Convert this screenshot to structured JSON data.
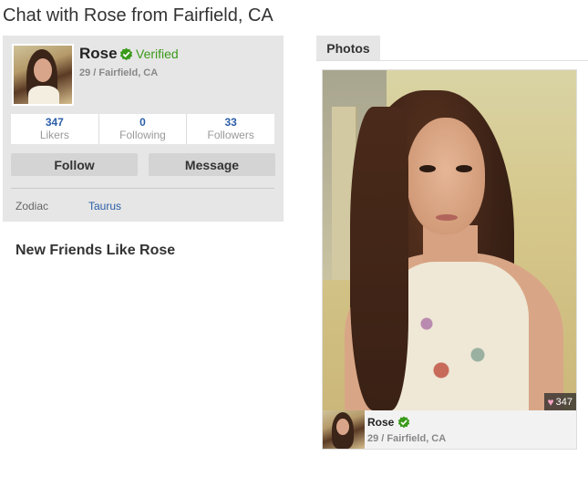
{
  "page": {
    "title": "Chat with Rose from Fairfield, CA"
  },
  "profile": {
    "name": "Rose",
    "verified_label": "Verified",
    "meta": "29 / Fairfield, CA",
    "stats": [
      {
        "value": "347",
        "label": "Likers"
      },
      {
        "value": "0",
        "label": "Following"
      },
      {
        "value": "33",
        "label": "Followers"
      }
    ],
    "buttons": {
      "follow": "Follow",
      "message": "Message"
    },
    "details": {
      "zodiac_label": "Zodiac",
      "zodiac_value": "Taurus"
    }
  },
  "friends_section": {
    "title": "New Friends Like Rose"
  },
  "photos": {
    "tab_label": "Photos",
    "likes": "347",
    "footer_name": "Rose",
    "footer_meta": "29 / Fairfield, CA"
  },
  "colors": {
    "verified": "#3a9a1a",
    "link": "#2b5ea8"
  },
  "icons": {
    "verified": "verified-check-badge-icon",
    "like": "heart-icon"
  }
}
